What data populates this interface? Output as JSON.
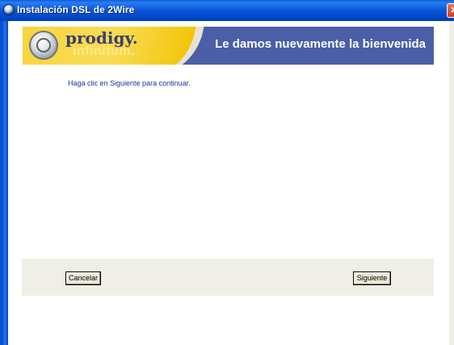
{
  "window": {
    "title": "Instalación DSL de 2Wire"
  },
  "banner": {
    "logo_word1": "prodigy",
    "logo_dot": ".",
    "logo_word2": "infinitum",
    "logo_dot2": ".",
    "welcome": "Le damos nuevamente la bienvenida"
  },
  "main": {
    "instruction": "Haga clic en Siguiente para continuar."
  },
  "buttons": {
    "cancel": "Cancelar",
    "next": "Siguiente"
  },
  "colors": {
    "titlebar": "#0a55d8",
    "banner": "#4a5fa8",
    "logo_yellow": "#f7d43a",
    "instruction_text": "#1f2f9b"
  }
}
